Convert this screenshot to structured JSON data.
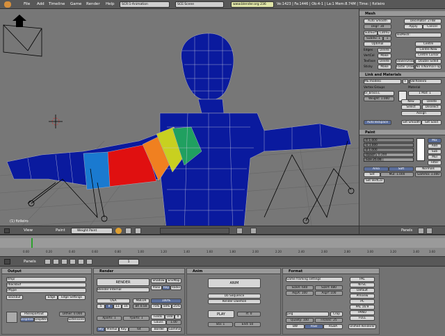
{
  "top": {
    "menus": [
      "File",
      "Add",
      "Timeline",
      "Game",
      "Render",
      "Help"
    ],
    "scr": "SCR:1-Animation",
    "sce": "SCE:Scene",
    "url": "www.blender.org 236",
    "stats": "Ve:1423 | Fa:1446 | Ob:4-1 | La:1  Mem:8.74M | Time: | fizileiro"
  },
  "viewport": {
    "label": "(1) fizileiro",
    "view": "View",
    "paint": "Paint",
    "mode": "Weight Paint"
  },
  "mesh": {
    "title": "Mesh",
    "auto_smooth": "Auto Smooth",
    "degr": "Degr: 30",
    "decimator": "Decimator: 2748",
    "apply": "Apply",
    "cancel": "Cancel",
    "subsurf": "SubSurf",
    "catmu": "Catmu",
    "subdiv": "Subdiv: 1",
    "subdiv2": "1",
    "optimal": "Optimal",
    "texmesh": "TexMesh:",
    "edges": "Edges",
    "vertcol": "VertCol",
    "texface": "TexFace",
    "sticky": "Sticky",
    "delete1": "Delete",
    "make1": "Make",
    "delete2": "Delete",
    "make2": "Make",
    "slower_draw": "SlowerDraw",
    "faster_draw": "Faster Draw",
    "double_sided": "Double Sided",
    "no_v_normal": "No V.Normal Flip",
    "centre": "Centre",
    "centre_new": "Centre New",
    "centre_cursor": "Centre Cursor"
  },
  "link": {
    "title": "Link and Materials",
    "me": "ME:modelo",
    "f": "F",
    "ob": "OB:fizileiro",
    "vertex_groups": "Vertex Groups",
    "group": "br_braco.L",
    "weight": "Weight: 1.000",
    "material": "Material",
    "mat": "1 Mat: 1",
    "new": "New",
    "delete": "Delete",
    "select": "Select",
    "deselect": "Deselect",
    "assign": "Assign",
    "autotexspace": "AutoTexSpace",
    "set_smooth": "Set Smooth",
    "set_solid": "Set Solid"
  },
  "paint": {
    "title": "Paint",
    "r": "R 1.000",
    "g": "G 1.000",
    "b": "B 1.000",
    "opacity": "Opacity 0.200",
    "size": "Size 25.00",
    "modes": [
      "Mix",
      "Add",
      "Sub",
      "Mul",
      "Filter"
    ],
    "area": "Area",
    "soft": "Soft",
    "normals": "Normals",
    "set": "Set",
    "mul": "Mul: 1.000",
    "gamma": "Gamma: 1.000",
    "set_vertcol": "Set VertCol"
  },
  "timeline": {
    "ticks": [
      "0.00",
      "0.20",
      "0.40",
      "0.60",
      "0.80",
      "1.00",
      "1.20",
      "1.40",
      "1.60",
      "1.80",
      "2.00",
      "2.20",
      "2.40",
      "2.60",
      "2.80",
      "3.00",
      "3.20",
      "3.40",
      "3.60",
      "3.80",
      "4.00"
    ],
    "panels": "Panels",
    "frame": "1"
  },
  "output": {
    "title": "Output",
    "paths": [
      "/tmp/",
      "//backbuf",
      "//ftype"
    ],
    "backbuf": "Backbuf",
    "edge": "Edge",
    "edge_settings": "Edge Settings",
    "passepartout": "Passepartout",
    "dither": "Dither: 0.000",
    "dispview": "DispView",
    "dispwin": "DispWin",
    "extensions": "Extensions"
  },
  "render": {
    "title": "Render",
    "render": "RENDER",
    "shadow": "Shadow",
    "envmap": "EnvMap",
    "engine": "Blender Internal",
    "pano": "Pano",
    "ray": "Ray",
    "radio": "Radio",
    "osa": "OSA",
    "osa_vals": [
      "5",
      "8",
      "11",
      "16"
    ],
    "mblur": "MBLUR",
    "bf": "Bf: 0.50",
    "percent": [
      "100%",
      "75%",
      "50%",
      "25%"
    ],
    "xparts": "Xparts: 1",
    "yparts": "Yparts: 1",
    "fields": "Fields",
    "odd": "Odd",
    "x": "X",
    "gauss": "Gauss",
    "gauss_val": "1.00",
    "sky": "Sky",
    "premul": "Premul",
    "key": "Key",
    "key_val": "64",
    "border": "Border",
    "gamma": "Gamma"
  },
  "anim": {
    "title": "Anim",
    "anim": "ANIM",
    "do_sequence": "Do Sequence",
    "render_daemon": "Render Daemon",
    "play": "PLAY",
    "rt": "rt: 0",
    "sta": "Sta: 1",
    "end": "End: 50"
  },
  "format": {
    "title": "Format",
    "preset": "Game framing settings",
    "sizex": "SizeX: 640",
    "sizey": "SizeY: 480",
    "aspx": "AspX: 100",
    "aspy": "AspY: 100",
    "jpeg": "Jpeg",
    "crop": "Crop",
    "quality": "Quality: 100",
    "frs": "Frs/sec: 25",
    "bw": "BW",
    "rgb": "RGB",
    "rgba": "RGBA",
    "presets": [
      "PAL",
      "NTSC",
      "Default",
      "Preview",
      "PC",
      "PAL 16:9",
      "PANO",
      "FULL",
      "Unified Renderer"
    ]
  }
}
